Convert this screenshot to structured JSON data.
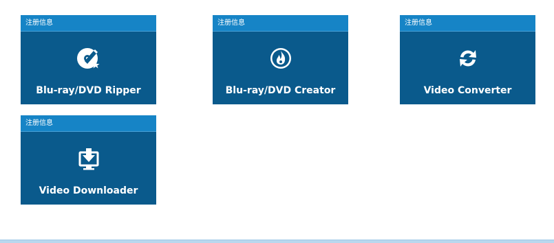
{
  "tiles": [
    {
      "header": "注册信息",
      "label": "Blu-ray/DVD Ripper",
      "icon": "disc-ripper-icon"
    },
    {
      "header": "注册信息",
      "label": "Blu-ray/DVD Creator",
      "icon": "disc-burn-icon"
    },
    {
      "header": "注册信息",
      "label": "Video Converter",
      "icon": "convert-arrows-icon"
    },
    {
      "header": "注册信息",
      "label": "Video Downloader",
      "icon": "download-monitor-icon"
    }
  ],
  "colors": {
    "tile_body": "#0a5a8c",
    "tile_header": "#1684c6",
    "text": "#ffffff"
  }
}
